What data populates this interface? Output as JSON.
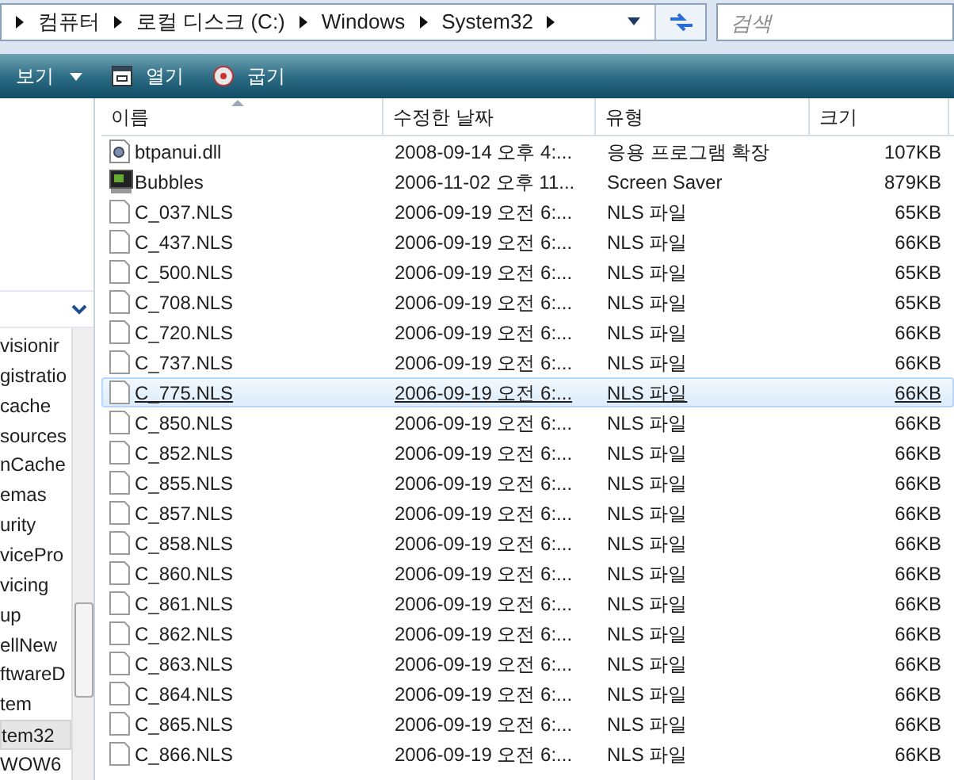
{
  "address_bar": {
    "crumbs": [
      "컴퓨터",
      "로컬 디스크 (C:)",
      "Windows",
      "System32"
    ]
  },
  "search": {
    "placeholder": "검색"
  },
  "toolbar": {
    "items": [
      {
        "label": "보기",
        "kind": "views"
      },
      {
        "label": "열기",
        "kind": "open"
      },
      {
        "label": "굽기",
        "kind": "burn"
      }
    ]
  },
  "tree": {
    "items": [
      {
        "label": "visionir",
        "selected": false
      },
      {
        "label": "gistratio",
        "selected": false
      },
      {
        "label": "cache",
        "selected": false
      },
      {
        "label": "sources",
        "selected": false
      },
      {
        "label": "nCache",
        "selected": false
      },
      {
        "label": "emas",
        "selected": false
      },
      {
        "label": "urity",
        "selected": false
      },
      {
        "label": "vicePro",
        "selected": false
      },
      {
        "label": "vicing",
        "selected": false
      },
      {
        "label": "up",
        "selected": false
      },
      {
        "label": "ellNew",
        "selected": false
      },
      {
        "label": "ftwareD",
        "selected": false
      },
      {
        "label": "tem",
        "selected": false
      },
      {
        "label": "tem32",
        "selected": true
      },
      {
        "label": "WOW6",
        "selected": false
      }
    ]
  },
  "table": {
    "columns": [
      "이름",
      "수정한 날짜",
      "유형",
      "크기"
    ],
    "rows": [
      {
        "name": "btpanui.dll",
        "kind": "dll",
        "date": "2008-09-14 오후 4:...",
        "type": "응용 프로그램 확장",
        "size": "107KB",
        "selected": false
      },
      {
        "name": "Bubbles",
        "kind": "screensaver",
        "date": "2006-11-02 오후 11...",
        "type": "Screen Saver",
        "size": "879KB",
        "selected": false
      },
      {
        "name": "C_037.NLS",
        "kind": "file",
        "date": "2006-09-19 오전 6:...",
        "type": "NLS 파일",
        "size": "65KB",
        "selected": false
      },
      {
        "name": "C_437.NLS",
        "kind": "file",
        "date": "2006-09-19 오전 6:...",
        "type": "NLS 파일",
        "size": "66KB",
        "selected": false
      },
      {
        "name": "C_500.NLS",
        "kind": "file",
        "date": "2006-09-19 오전 6:...",
        "type": "NLS 파일",
        "size": "65KB",
        "selected": false
      },
      {
        "name": "C_708.NLS",
        "kind": "file",
        "date": "2006-09-19 오전 6:...",
        "type": "NLS 파일",
        "size": "65KB",
        "selected": false
      },
      {
        "name": "C_720.NLS",
        "kind": "file",
        "date": "2006-09-19 오전 6:...",
        "type": "NLS 파일",
        "size": "66KB",
        "selected": false
      },
      {
        "name": "C_737.NLS",
        "kind": "file",
        "date": "2006-09-19 오전 6:...",
        "type": "NLS 파일",
        "size": "66KB",
        "selected": false
      },
      {
        "name": "C_775.NLS",
        "kind": "file",
        "date": "2006-09-19 오전 6:...",
        "type": "NLS 파일",
        "size": "66KB",
        "selected": true
      },
      {
        "name": "C_850.NLS",
        "kind": "file",
        "date": "2006-09-19 오전 6:...",
        "type": "NLS 파일",
        "size": "66KB",
        "selected": false
      },
      {
        "name": "C_852.NLS",
        "kind": "file",
        "date": "2006-09-19 오전 6:...",
        "type": "NLS 파일",
        "size": "66KB",
        "selected": false
      },
      {
        "name": "C_855.NLS",
        "kind": "file",
        "date": "2006-09-19 오전 6:...",
        "type": "NLS 파일",
        "size": "66KB",
        "selected": false
      },
      {
        "name": "C_857.NLS",
        "kind": "file",
        "date": "2006-09-19 오전 6:...",
        "type": "NLS 파일",
        "size": "66KB",
        "selected": false
      },
      {
        "name": "C_858.NLS",
        "kind": "file",
        "date": "2006-09-19 오전 6:...",
        "type": "NLS 파일",
        "size": "66KB",
        "selected": false
      },
      {
        "name": "C_860.NLS",
        "kind": "file",
        "date": "2006-09-19 오전 6:...",
        "type": "NLS 파일",
        "size": "66KB",
        "selected": false
      },
      {
        "name": "C_861.NLS",
        "kind": "file",
        "date": "2006-09-19 오전 6:...",
        "type": "NLS 파일",
        "size": "66KB",
        "selected": false
      },
      {
        "name": "C_862.NLS",
        "kind": "file",
        "date": "2006-09-19 오전 6:...",
        "type": "NLS 파일",
        "size": "66KB",
        "selected": false
      },
      {
        "name": "C_863.NLS",
        "kind": "file",
        "date": "2006-09-19 오전 6:...",
        "type": "NLS 파일",
        "size": "66KB",
        "selected": false
      },
      {
        "name": "C_864.NLS",
        "kind": "file",
        "date": "2006-09-19 오전 6:...",
        "type": "NLS 파일",
        "size": "66KB",
        "selected": false
      },
      {
        "name": "C_865.NLS",
        "kind": "file",
        "date": "2006-09-19 오전 6:...",
        "type": "NLS 파일",
        "size": "66KB",
        "selected": false
      },
      {
        "name": "C_866.NLS",
        "kind": "file",
        "date": "2006-09-19 오전 6:...",
        "type": "NLS 파일",
        "size": "66KB",
        "selected": false
      }
    ]
  }
}
